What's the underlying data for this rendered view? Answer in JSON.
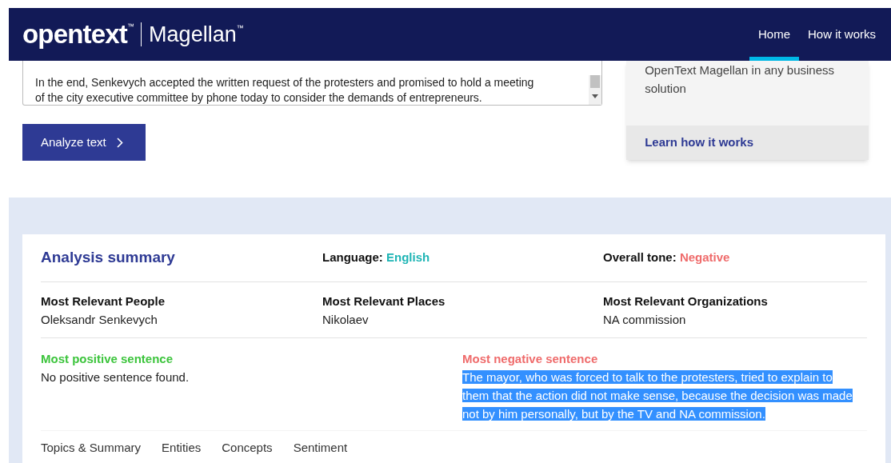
{
  "header": {
    "brand": "opentext",
    "brand_mark": "™",
    "product": "Magellan",
    "product_mark": "™",
    "nav": [
      {
        "label": "Home",
        "selected": true
      },
      {
        "label": "How it works",
        "selected": false
      }
    ]
  },
  "input_text": {
    "lines": [
      "In the end, Senkevych accepted the written request of the protesters and promised to hold a meeting",
      "of the city executive committee by phone today to consider the demands of entrepreneurs."
    ]
  },
  "analyze_button": {
    "label": "Analyze text"
  },
  "side_card": {
    "text": "OpenText Magellan in any business solution",
    "link": "Learn how it works"
  },
  "summary": {
    "title": "Analysis summary",
    "language": {
      "label": "Language:",
      "value": "English",
      "color": "#1fb5b5"
    },
    "tone": {
      "label": "Overall tone:",
      "value": "Negative",
      "color": "#ef6b6b"
    },
    "relevant": [
      {
        "label": "Most Relevant People",
        "value": "Oleksandr Senkevych"
      },
      {
        "label": "Most Relevant Places",
        "value": "Nikolaev"
      },
      {
        "label": "Most Relevant Organizations",
        "value": "NA commission"
      }
    ],
    "sentences": [
      {
        "label": "Most positive sentence",
        "color": "#3cc43c",
        "text": "No positive sentence found.",
        "highlighted": false
      },
      {
        "label": "Most negative sentence",
        "color": "#ef6b6b",
        "text": "The mayor, who was forced to talk to the protesters, tried to explain to them that the action did not make sense, because the decision was made not by him personally, but by the TV and NA commission.",
        "highlighted": true
      }
    ]
  },
  "result_tabs": [
    {
      "label": "Topics & Summary"
    },
    {
      "label": "Entities"
    },
    {
      "label": "Concepts"
    },
    {
      "label": "Sentiment"
    }
  ]
}
